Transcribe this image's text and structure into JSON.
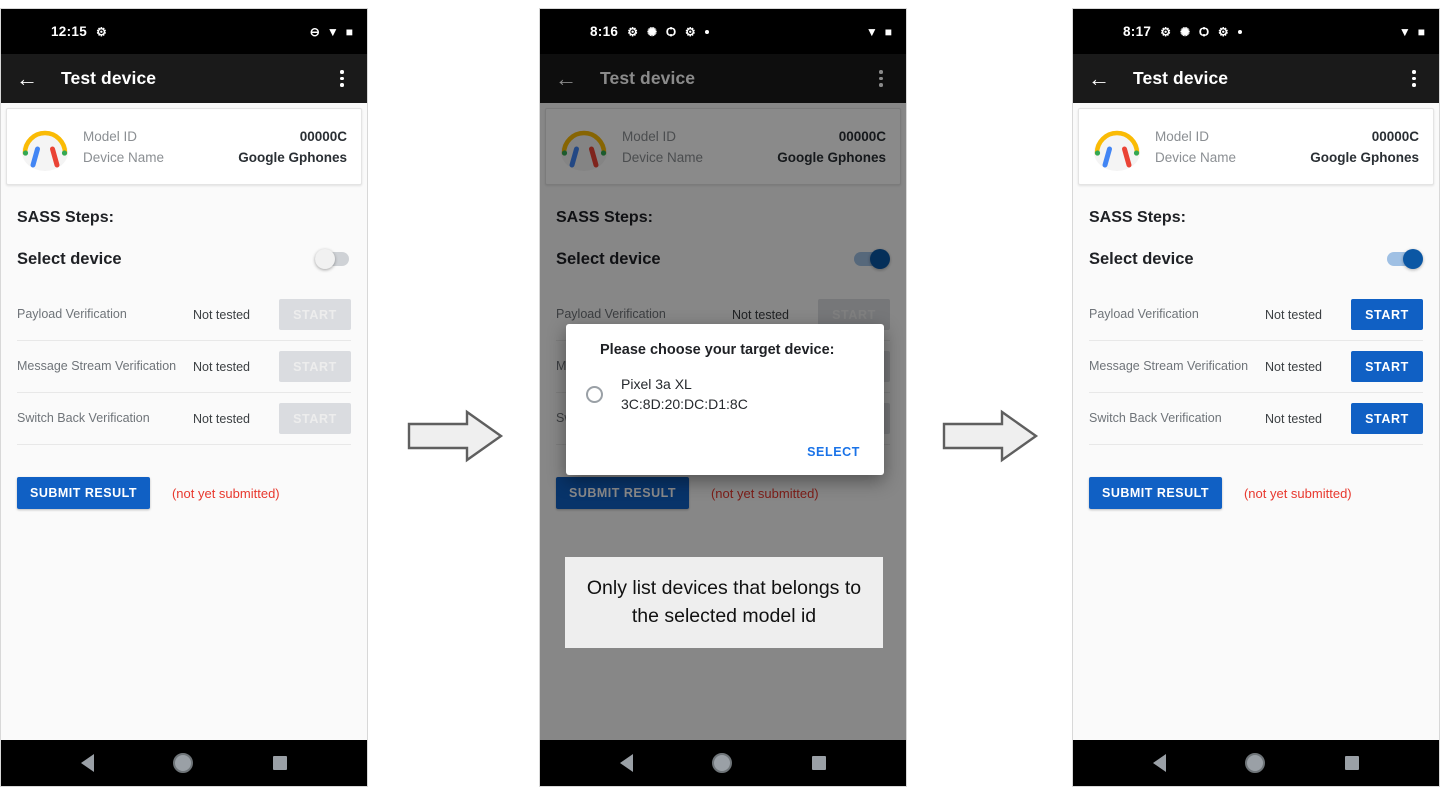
{
  "panels": [
    {
      "id": "panel-1",
      "status_bar": {
        "time": "12:15",
        "icons": [
          "android-debug-icon",
          "do-not-disturb-icon",
          "wifi-icon",
          "battery-icon"
        ]
      },
      "app_bar": {
        "back_label": "←",
        "title": "Test device",
        "overflow_label": "more-options"
      },
      "device_card": {
        "icon": "headphones-icon",
        "rows": [
          {
            "label": "Model ID",
            "value": "00000C"
          },
          {
            "label": "Device Name",
            "value": "Google Gphones"
          }
        ]
      },
      "section_title": "SASS Steps:",
      "select_device": {
        "label": "Select device",
        "toggle_on": false
      },
      "tests": [
        {
          "name": "Payload Verification",
          "status": "Not tested",
          "button": "START",
          "enabled": false
        },
        {
          "name": "Message Stream Verification",
          "status": "Not tested",
          "button": "START",
          "enabled": false
        },
        {
          "name": "Switch Back Verification",
          "status": "Not tested",
          "button": "START",
          "enabled": false
        }
      ],
      "submit": {
        "label": "SUBMIT RESULT",
        "note": "(not yet submitted)"
      },
      "dialog": null,
      "annotation": null,
      "dimmed": false
    },
    {
      "id": "panel-2",
      "status_bar": {
        "time": "8:16",
        "icons": [
          "android-debug-icon",
          "sync-icon",
          "bluetooth-search-icon",
          "gear-icon",
          "dot-icon",
          "wifi-icon",
          "battery-icon"
        ]
      },
      "app_bar": {
        "back_label": "←",
        "title": "Test device",
        "overflow_label": "more-options"
      },
      "device_card": {
        "icon": "headphones-icon",
        "rows": [
          {
            "label": "Model ID",
            "value": "00000C"
          },
          {
            "label": "Device Name",
            "value": "Google Gphones"
          }
        ]
      },
      "section_title": "SASS Steps:",
      "select_device": {
        "label": "Select device",
        "toggle_on": true
      },
      "tests": [
        {
          "name": "Payload Verification",
          "status": "Not tested",
          "button": "START",
          "enabled": false
        },
        {
          "name": "Message Stream Verification",
          "status": "Not tested",
          "button": "START",
          "enabled": false
        },
        {
          "name": "Switch Back Verification",
          "status": "Not tested",
          "button": "START",
          "enabled": false
        }
      ],
      "submit": {
        "label": "SUBMIT RESULT",
        "note": "(not yet submitted)"
      },
      "dialog": {
        "title": "Please choose your target device:",
        "option_name": "Pixel 3a XL",
        "option_address": "3C:8D:20:DC:D1:8C",
        "option_selected": false,
        "action": "SELECT"
      },
      "annotation": "Only list devices that belongs to the selected model id",
      "dimmed": true
    },
    {
      "id": "panel-3",
      "status_bar": {
        "time": "8:17",
        "icons": [
          "android-debug-icon",
          "sync-icon",
          "bluetooth-search-icon",
          "gear-icon",
          "dot-icon",
          "wifi-icon",
          "battery-icon"
        ]
      },
      "app_bar": {
        "back_label": "←",
        "title": "Test device",
        "overflow_label": "more-options"
      },
      "device_card": {
        "icon": "headphones-icon",
        "rows": [
          {
            "label": "Model ID",
            "value": "00000C"
          },
          {
            "label": "Device Name",
            "value": "Google Gphones"
          }
        ]
      },
      "section_title": "SASS Steps:",
      "select_device": {
        "label": "Select device",
        "toggle_on": true
      },
      "tests": [
        {
          "name": "Payload Verification",
          "status": "Not tested",
          "button": "START",
          "enabled": true
        },
        {
          "name": "Message Stream Verification",
          "status": "Not tested",
          "button": "START",
          "enabled": true
        },
        {
          "name": "Switch Back Verification",
          "status": "Not tested",
          "button": "START",
          "enabled": true
        }
      ],
      "submit": {
        "label": "SUBMIT RESULT",
        "note": "(not yet submitted)"
      },
      "dialog": null,
      "annotation": null,
      "dimmed": false
    }
  ],
  "nav_bar": {
    "back": "back-button",
    "home": "home-button",
    "recents": "recents-button"
  },
  "flow_arrows": [
    {
      "id": "flow-arrow-1",
      "direction": "right"
    },
    {
      "id": "flow-arrow-2",
      "direction": "right"
    }
  ],
  "colors": {
    "accent_blue": "#1060c4",
    "link_blue": "#1a73e8",
    "error_red": "#e8382e",
    "disabled_gray": "#dadce0",
    "app_bar": "#1a1a1a",
    "background": "#fafafa",
    "annotation_bg": "#eeeeee"
  }
}
